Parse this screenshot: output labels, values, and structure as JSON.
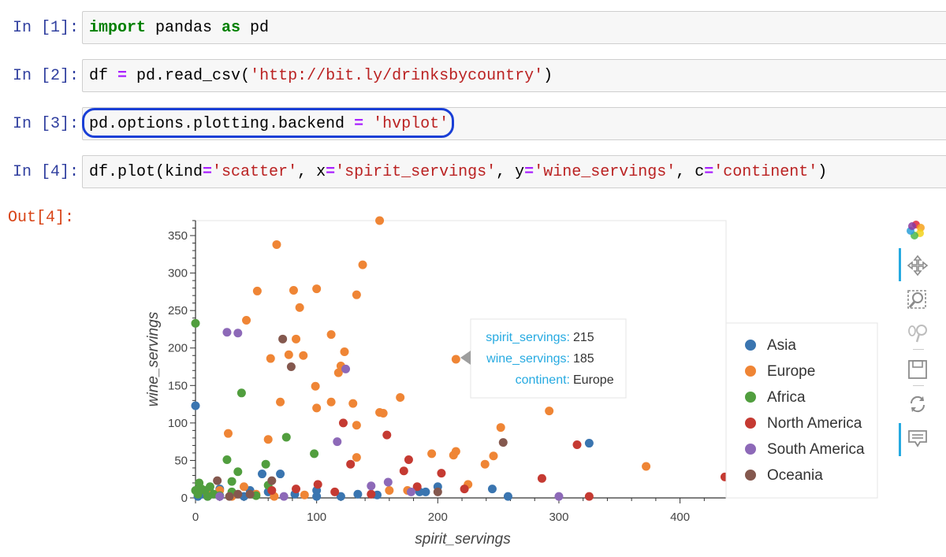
{
  "cells": [
    {
      "prompt": "In [1]:",
      "tokens": [
        {
          "t": "import",
          "c": "kw"
        },
        {
          "t": " pandas ",
          "c": ""
        },
        {
          "t": "as",
          "c": "kw"
        },
        {
          "t": " pd",
          "c": ""
        }
      ]
    },
    {
      "prompt": "In [2]:",
      "tokens": [
        {
          "t": "df ",
          "c": ""
        },
        {
          "t": "=",
          "c": "op"
        },
        {
          "t": " pd.read_csv",
          "c": ""
        },
        {
          "t": "(",
          "c": "paren"
        },
        {
          "t": "'http://bit.ly/drinksbycountry'",
          "c": "str"
        },
        {
          "t": ")",
          "c": "paren"
        }
      ]
    },
    {
      "prompt": "In [3]:",
      "tokens": [
        {
          "t": "pd.options.plotting.backend ",
          "c": ""
        },
        {
          "t": "=",
          "c": "op"
        },
        {
          "t": " ",
          "c": ""
        },
        {
          "t": "'hvplot'",
          "c": "str"
        }
      ]
    },
    {
      "prompt": "In [4]:",
      "tokens": [
        {
          "t": "df.plot(kind",
          "c": ""
        },
        {
          "t": "=",
          "c": "op"
        },
        {
          "t": "'scatter'",
          "c": "str"
        },
        {
          "t": ", x",
          "c": ""
        },
        {
          "t": "=",
          "c": "op"
        },
        {
          "t": "'spirit_servings'",
          "c": "str"
        },
        {
          "t": ", y",
          "c": ""
        },
        {
          "t": "=",
          "c": "op"
        },
        {
          "t": "'wine_servings'",
          "c": "str"
        },
        {
          "t": ", c",
          "c": ""
        },
        {
          "t": "=",
          "c": "op"
        },
        {
          "t": "'continent'",
          "c": "str"
        },
        {
          "t": ")",
          "c": ""
        }
      ]
    }
  ],
  "output_prompt": "Out[4]:",
  "tooltip": {
    "rows": [
      {
        "key": "spirit_servings:",
        "value": "215"
      },
      {
        "key": "wine_servings:",
        "value": "185"
      },
      {
        "key": "continent:",
        "value": "Europe"
      }
    ]
  },
  "chart_data": {
    "type": "scatter",
    "xlabel": "spirit_servings",
    "ylabel": "wine_servings",
    "xlim": [
      0,
      438
    ],
    "ylim": [
      0,
      370
    ],
    "xticks": [
      0,
      100,
      200,
      300,
      400
    ],
    "yticks": [
      0,
      50,
      100,
      150,
      200,
      250,
      300,
      350
    ],
    "legend_position": "right",
    "series": [
      {
        "name": "Asia",
        "color": "#3a75b0",
        "points": [
          [
            0,
            123
          ],
          [
            325,
            73
          ],
          [
            55,
            32
          ],
          [
            70,
            32
          ],
          [
            45,
            10
          ],
          [
            30,
            5
          ],
          [
            5,
            5
          ],
          [
            12,
            8
          ],
          [
            100,
            10
          ],
          [
            120,
            2
          ],
          [
            190,
            8
          ],
          [
            200,
            15
          ],
          [
            245,
            12
          ],
          [
            258,
            2
          ],
          [
            60,
            8
          ],
          [
            20,
            12
          ],
          [
            150,
            4
          ],
          [
            185,
            8
          ],
          [
            100,
            2
          ],
          [
            2,
            2
          ],
          [
            82,
            5
          ],
          [
            40,
            2
          ],
          [
            10,
            2
          ],
          [
            134,
            5
          ]
        ]
      },
      {
        "name": "Europe",
        "color": "#ef8535",
        "points": [
          [
            152,
            370
          ],
          [
            67,
            338
          ],
          [
            138,
            311
          ],
          [
            51,
            276
          ],
          [
            100,
            279
          ],
          [
            81,
            277
          ],
          [
            133,
            271
          ],
          [
            86,
            254
          ],
          [
            42,
            237
          ],
          [
            112,
            218
          ],
          [
            123,
            195
          ],
          [
            89,
            190
          ],
          [
            62,
            186
          ],
          [
            215,
            185
          ],
          [
            120,
            176
          ],
          [
            118,
            167
          ],
          [
            77,
            191
          ],
          [
            99,
            149
          ],
          [
            83,
            212
          ],
          [
            112,
            128
          ],
          [
            70,
            128
          ],
          [
            130,
            126
          ],
          [
            155,
            113
          ],
          [
            152,
            114
          ],
          [
            169,
            134
          ],
          [
            100,
            120
          ],
          [
            133,
            97
          ],
          [
            252,
            94
          ],
          [
            292,
            116
          ],
          [
            27,
            86
          ],
          [
            60,
            78
          ],
          [
            215,
            62
          ],
          [
            213,
            57
          ],
          [
            246,
            56
          ],
          [
            195,
            59
          ],
          [
            133,
            54
          ],
          [
            239,
            45
          ],
          [
            372,
            42
          ],
          [
            225,
            18
          ],
          [
            40,
            15
          ],
          [
            175,
            10
          ],
          [
            160,
            10
          ],
          [
            50,
            5
          ],
          [
            20,
            10
          ],
          [
            10,
            5
          ],
          [
            30,
            2
          ],
          [
            65,
            2
          ],
          [
            90,
            4
          ]
        ]
      },
      {
        "name": "Africa",
        "color": "#519e3e",
        "points": [
          [
            0,
            233
          ],
          [
            38,
            140
          ],
          [
            75,
            81
          ],
          [
            98,
            59
          ],
          [
            26,
            51
          ],
          [
            58,
            45
          ],
          [
            35,
            35
          ],
          [
            30,
            22
          ],
          [
            3,
            20
          ],
          [
            8,
            10
          ],
          [
            15,
            5
          ],
          [
            60,
            17
          ],
          [
            20,
            3
          ],
          [
            0,
            10
          ],
          [
            5,
            12
          ],
          [
            10,
            2
          ],
          [
            30,
            8
          ],
          [
            50,
            3
          ],
          [
            2,
            5
          ],
          [
            12,
            15
          ]
        ]
      },
      {
        "name": "North America",
        "color": "#c53a32",
        "points": [
          [
            122,
            100
          ],
          [
            158,
            84
          ],
          [
            315,
            71
          ],
          [
            176,
            51
          ],
          [
            172,
            36
          ],
          [
            128,
            45
          ],
          [
            286,
            26
          ],
          [
            203,
            33
          ],
          [
            222,
            12
          ],
          [
            101,
            18
          ],
          [
            83,
            12
          ],
          [
            437,
            28
          ],
          [
            325,
            2
          ],
          [
            115,
            8
          ],
          [
            145,
            5
          ],
          [
            183,
            15
          ],
          [
            63,
            10
          ]
        ]
      },
      {
        "name": "South America",
        "color": "#8d69b8",
        "points": [
          [
            26,
            221
          ],
          [
            35,
            220
          ],
          [
            124,
            172
          ],
          [
            117,
            75
          ],
          [
            159,
            21
          ],
          [
            145,
            16
          ],
          [
            300,
            2
          ],
          [
            178,
            8
          ],
          [
            73,
            2
          ],
          [
            20,
            2
          ]
        ]
      },
      {
        "name": "Oceania",
        "color": "#84584e",
        "points": [
          [
            72,
            212
          ],
          [
            79,
            175
          ],
          [
            254,
            74
          ],
          [
            18,
            23
          ],
          [
            200,
            8
          ],
          [
            63,
            23
          ],
          [
            35,
            5
          ],
          [
            45,
            5
          ],
          [
            28,
            2
          ]
        ]
      }
    ]
  },
  "toolbar": [
    "bokeh-logo-icon",
    "pan-icon",
    "box-zoom-icon",
    "wheel-zoom-icon",
    "save-icon",
    "reset-icon",
    "hover-icon"
  ]
}
